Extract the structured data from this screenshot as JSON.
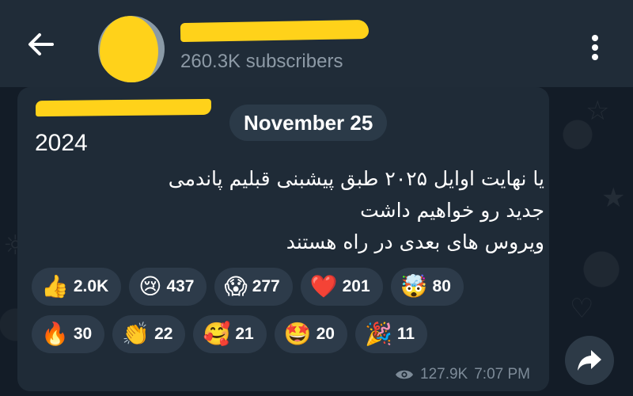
{
  "header": {
    "subscribers": "260.3K subscribers"
  },
  "post": {
    "date": "November 25",
    "year": "2024",
    "lines": [
      "یا نهایت اوایل ۲۰۲۵ طبق پیشبنی قبلیم پاندمی",
      "جدید رو خواهیم داشت",
      "ویروس های بعدی در راه هستند"
    ],
    "reactions_row1": [
      {
        "icon": "thumbs-up-icon",
        "emoji": "👍",
        "count": "2.0K"
      },
      {
        "icon": "crying-face-icon",
        "emoji": "😢",
        "count": "437"
      },
      {
        "icon": "screaming-face-icon",
        "emoji": "😱",
        "count": "277"
      },
      {
        "icon": "red-heart-icon",
        "emoji": "❤️",
        "count": "201"
      },
      {
        "icon": "exploding-head-icon",
        "emoji": "🤯",
        "count": "80"
      }
    ],
    "reactions_row2": [
      {
        "icon": "fire-icon",
        "emoji": "🔥",
        "count": "30"
      },
      {
        "icon": "clapping-hands-icon",
        "emoji": "👏",
        "count": "22"
      },
      {
        "icon": "smiling-hearts-icon",
        "emoji": "🥰",
        "count": "21"
      },
      {
        "icon": "star-struck-icon",
        "emoji": "🤩",
        "count": "20"
      },
      {
        "icon": "party-popper-icon",
        "emoji": "🎉",
        "count": "11"
      }
    ],
    "views": "127.9K",
    "time": "7:07 PM"
  },
  "colors": {
    "accent_redaction": "#ffd21a",
    "header_bg": "#202c38",
    "bubble_bg": "#1f2b37",
    "reaction_bg": "#2d3b4a"
  }
}
